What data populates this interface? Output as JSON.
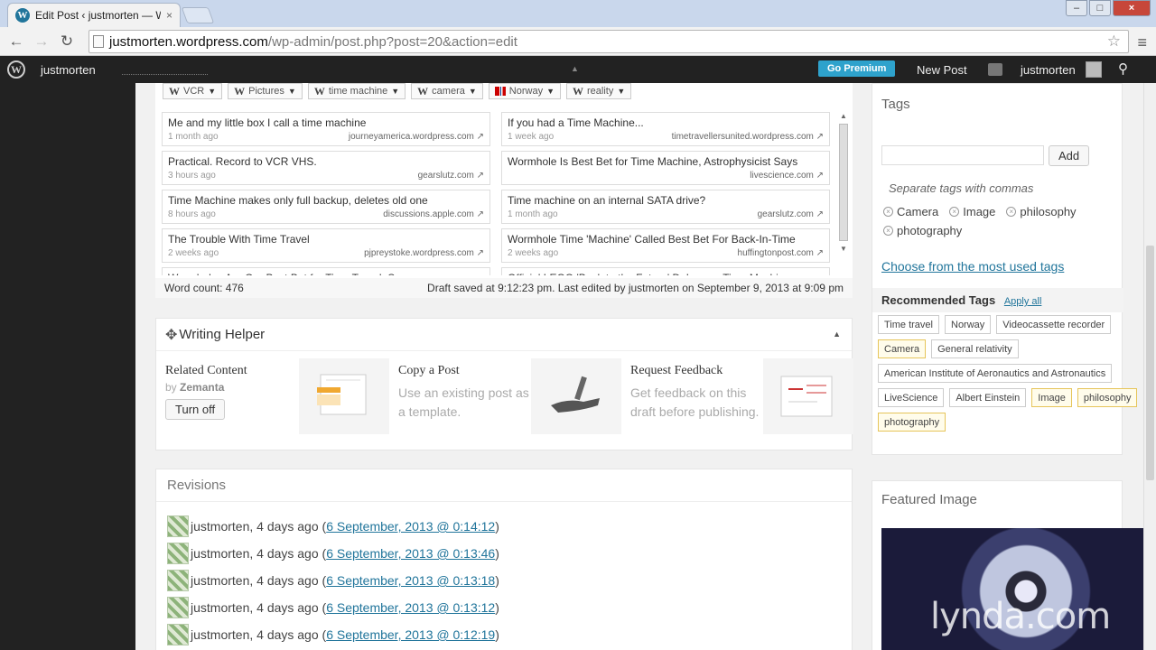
{
  "browser": {
    "tab_title": "Edit Post ‹ justmorten — W",
    "url_host": "justmorten.wordpress.com",
    "url_path": "/wp-admin/post.php?post=20&action=edit"
  },
  "adminbar": {
    "site_name": "justmorten",
    "go_premium": "Go Premium",
    "new_post": "New Post",
    "user": "justmorten"
  },
  "zemanta": {
    "tag_chips": [
      {
        "label": "VCR",
        "icon": "wiki"
      },
      {
        "label": "Pictures",
        "icon": "wiki"
      },
      {
        "label": "time machine",
        "icon": "wiki"
      },
      {
        "label": "camera",
        "icon": "wiki"
      },
      {
        "label": "Norway",
        "icon": "flag"
      },
      {
        "label": "reality",
        "icon": "wiki"
      }
    ],
    "articles": [
      {
        "title": "Me and my little box I call a time machine",
        "age": "1 month ago",
        "source": "journeyamerica.wordpress.com"
      },
      {
        "title": "If you had a Time Machine...",
        "age": "1 week ago",
        "source": "timetravellersunited.wordpress.com"
      },
      {
        "title": "Practical. Record to VCR VHS.",
        "age": "3 hours ago",
        "source": "gearslutz.com"
      },
      {
        "title": "Wormhole Is Best Bet for Time Machine, Astrophysicist Says",
        "age": "",
        "source": "livescience.com"
      },
      {
        "title": "Time Machine makes only full backup, deletes old one",
        "age": "8 hours ago",
        "source": "discussions.apple.com"
      },
      {
        "title": "Time machine on an internal SATA drive?",
        "age": "1 month ago",
        "source": "gearslutz.com"
      },
      {
        "title": "The Trouble With Time Travel",
        "age": "2 weeks ago",
        "source": "pjpreystoke.wordpress.com"
      },
      {
        "title": "Wormhole Time 'Machine' Called Best Bet For Back-In-Time",
        "age": "2 weeks ago",
        "source": "huffingtonpost.com"
      },
      {
        "title": "Wormholes Are Our Best Bet for Time Travel, Says",
        "age": "",
        "source": ""
      },
      {
        "title": "Official LEGO 'Back to the Future' DeLorean Time Machine",
        "age": "",
        "source": ""
      }
    ],
    "word_count": "Word count: 476",
    "draft_saved": "Draft saved at 9:12:23 pm. Last edited by justmorten on September 9, 2013 at 9:09 pm"
  },
  "helper": {
    "title": "Writing Helper",
    "related_title": "Related Content",
    "related_by": "by",
    "related_brand": "Zemanta",
    "turn_off": "Turn off",
    "copy_title": "Copy a Post",
    "copy_desc": "Use an existing post as a template.",
    "feedback_title": "Request Feedback",
    "feedback_desc": "Get feedback on this draft before publishing."
  },
  "revisions": {
    "title": "Revisions",
    "items": [
      {
        "author": "justmorten, 4 days ago (",
        "link": "6 September, 2013 @ 0:14:12",
        "close": ")"
      },
      {
        "author": "justmorten, 4 days ago (",
        "link": "6 September, 2013 @ 0:13:46",
        "close": ")"
      },
      {
        "author": "justmorten, 4 days ago (",
        "link": "6 September, 2013 @ 0:13:18",
        "close": ")"
      },
      {
        "author": "justmorten, 4 days ago (",
        "link": "6 September, 2013 @ 0:13:12",
        "close": ")"
      },
      {
        "author": "justmorten, 4 days ago (",
        "link": "6 September, 2013 @ 0:12:19",
        "close": ")"
      }
    ]
  },
  "tags": {
    "title": "Tags",
    "add": "Add",
    "hint": "Separate tags with commas",
    "current": [
      "Camera",
      "Image",
      "philosophy",
      "photography"
    ],
    "choose_link": "Choose from the most used tags",
    "recommended_title": "Recommended Tags",
    "apply_all": "Apply all",
    "recommended": [
      {
        "label": "Time travel",
        "highlight": false
      },
      {
        "label": "Norway",
        "highlight": false
      },
      {
        "label": "Videocassette recorder",
        "highlight": false
      },
      {
        "label": "Camera",
        "highlight": true
      },
      {
        "label": "General relativity",
        "highlight": false
      },
      {
        "label": "American Institute of Aeronautics and Astronautics",
        "highlight": false
      },
      {
        "label": "LiveScience",
        "highlight": false
      },
      {
        "label": "Albert Einstein",
        "highlight": false
      },
      {
        "label": "Image",
        "highlight": true
      },
      {
        "label": "philosophy",
        "highlight": true
      },
      {
        "label": "photography",
        "highlight": true
      }
    ]
  },
  "featured": {
    "title": "Featured Image"
  },
  "watermark": "lynda.com"
}
